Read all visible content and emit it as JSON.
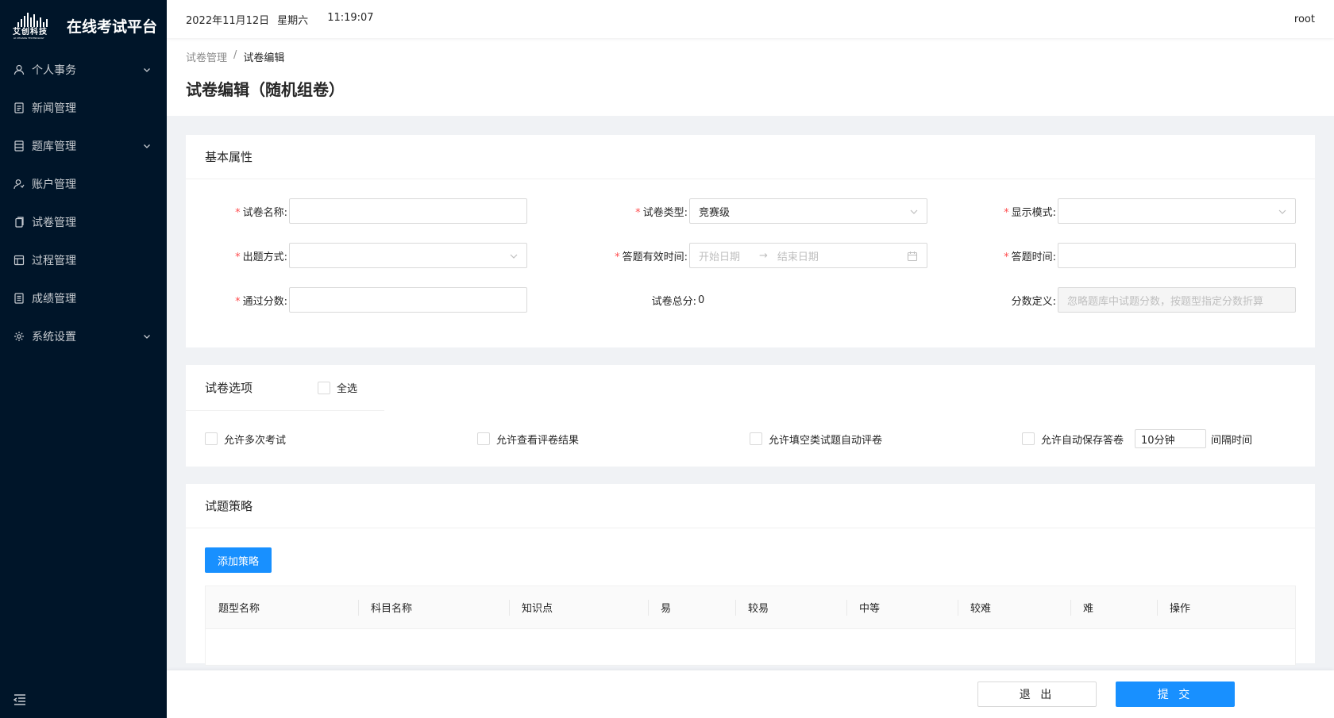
{
  "brand": {
    "logo_text": "艾创科技",
    "logo_subtext": "AI CHUANG TECHNOLOGY",
    "app_title": "在线考试平台"
  },
  "sidebar": {
    "items": [
      {
        "label": "个人事务",
        "icon": "user-icon",
        "has_children": true
      },
      {
        "label": "新闻管理",
        "icon": "news-icon",
        "has_children": false
      },
      {
        "label": "题库管理",
        "icon": "database-icon",
        "has_children": true
      },
      {
        "label": "账户管理",
        "icon": "account-icon",
        "has_children": false
      },
      {
        "label": "试卷管理",
        "icon": "paper-icon",
        "has_children": false
      },
      {
        "label": "过程管理",
        "icon": "process-icon",
        "has_children": false
      },
      {
        "label": "成绩管理",
        "icon": "score-icon",
        "has_children": false
      },
      {
        "label": "系统设置",
        "icon": "gear-icon",
        "has_children": true
      }
    ]
  },
  "header": {
    "date": "2022年11月12日",
    "weekday": "星期六",
    "time": "11:19:07",
    "user": "root"
  },
  "breadcrumb": {
    "parent": "试卷管理",
    "separator": "/",
    "current": "试卷编辑"
  },
  "page": {
    "title": "试卷编辑（随机组卷）"
  },
  "basic": {
    "title": "基本属性",
    "paper_name_label": "试卷名称:",
    "paper_name_value": "",
    "paper_type_label": "试卷类型:",
    "paper_type_value": "竞赛级",
    "display_mode_label": "显示模式:",
    "display_mode_value": "",
    "question_method_label": "出题方式:",
    "question_method_value": "",
    "valid_time_label": "答题有效时间:",
    "start_placeholder": "开始日期",
    "end_placeholder": "结束日期",
    "answer_time_label": "答题时间:",
    "answer_time_value": "",
    "pass_score_label": "通过分数:",
    "pass_score_value": "",
    "total_score_label": "试卷总分:",
    "total_score_value": "0",
    "score_def_label": "分数定义:",
    "score_def_placeholder": "忽略题库中试题分数，按题型指定分数折算"
  },
  "options": {
    "title": "试卷选项",
    "select_all": "全选",
    "items": [
      "允许多次考试",
      "允许查看评卷结果",
      "允许填空类试题自动评卷",
      "允许自动保存答卷"
    ],
    "interval_value": "10分钟",
    "interval_suffix": "间隔时间"
  },
  "strategy": {
    "title": "试题策略",
    "add_button": "添加策略",
    "columns": [
      "题型名称",
      "科目名称",
      "知识点",
      "易",
      "较易",
      "中等",
      "较难",
      "难",
      "操作"
    ]
  },
  "footer": {
    "exit_label": "退 出",
    "submit_label": "提 交"
  },
  "colors": {
    "sidebar_bg": "#001529",
    "primary": "#1890ff",
    "required": "#ff4d4f"
  }
}
